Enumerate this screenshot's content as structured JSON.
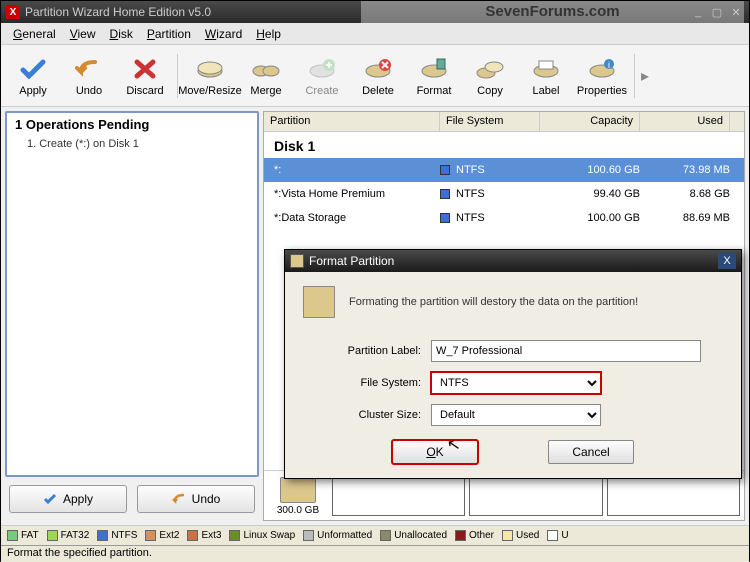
{
  "window": {
    "title": "Partition Wizard Home Edition v5.0",
    "watermark": "SevenForums.com"
  },
  "menu": {
    "general": "General",
    "view": "View",
    "disk": "Disk",
    "partition": "Partition",
    "wizard": "Wizard",
    "help": "Help"
  },
  "toolbar": {
    "apply": "Apply",
    "undo": "Undo",
    "discard": "Discard",
    "move": "Move/Resize",
    "merge": "Merge",
    "create": "Create",
    "delete": "Delete",
    "format": "Format",
    "copy": "Copy",
    "label": "Label",
    "properties": "Properties"
  },
  "ops": {
    "title": "1 Operations Pending",
    "item1": "1. Create (*:) on Disk 1"
  },
  "sidebtn": {
    "apply": "Apply",
    "undo": "Undo"
  },
  "grid": {
    "hdr": {
      "partition": "Partition",
      "fs": "File System",
      "capacity": "Capacity",
      "used": "Used"
    },
    "disk": "Disk 1",
    "r1": {
      "p": "*:",
      "fs": "NTFS",
      "cap": "100.60 GB",
      "used": "73.98 MB"
    },
    "r2": {
      "p": "*:Vista Home Premium",
      "fs": "NTFS",
      "cap": "99.40 GB",
      "used": "8.68 GB"
    },
    "r3": {
      "p": "*:Data Storage",
      "fs": "NTFS",
      "cap": "100.00 GB",
      "used": "88.69 MB"
    }
  },
  "diskbar": {
    "size": "300.0 GB"
  },
  "legend": {
    "fat": "FAT",
    "fat32": "FAT32",
    "ntfs": "NTFS",
    "ext2": "Ext2",
    "ext3": "Ext3",
    "swap": "Linux Swap",
    "unformatted": "Unformatted",
    "unallocated": "Unallocated",
    "other": "Other",
    "used": "Used",
    "un": "U"
  },
  "status": {
    "text": "Format the specified partition."
  },
  "dialog": {
    "title": "Format Partition",
    "warning": "Formating the partition will destory the data on the partition!",
    "lbl_partition": "Partition Label:",
    "val_partition": "W_7 Professional",
    "lbl_fs": "File System:",
    "val_fs": "NTFS",
    "lbl_cluster": "Cluster Size:",
    "val_cluster": "Default",
    "ok": "OK",
    "cancel": "Cancel"
  }
}
